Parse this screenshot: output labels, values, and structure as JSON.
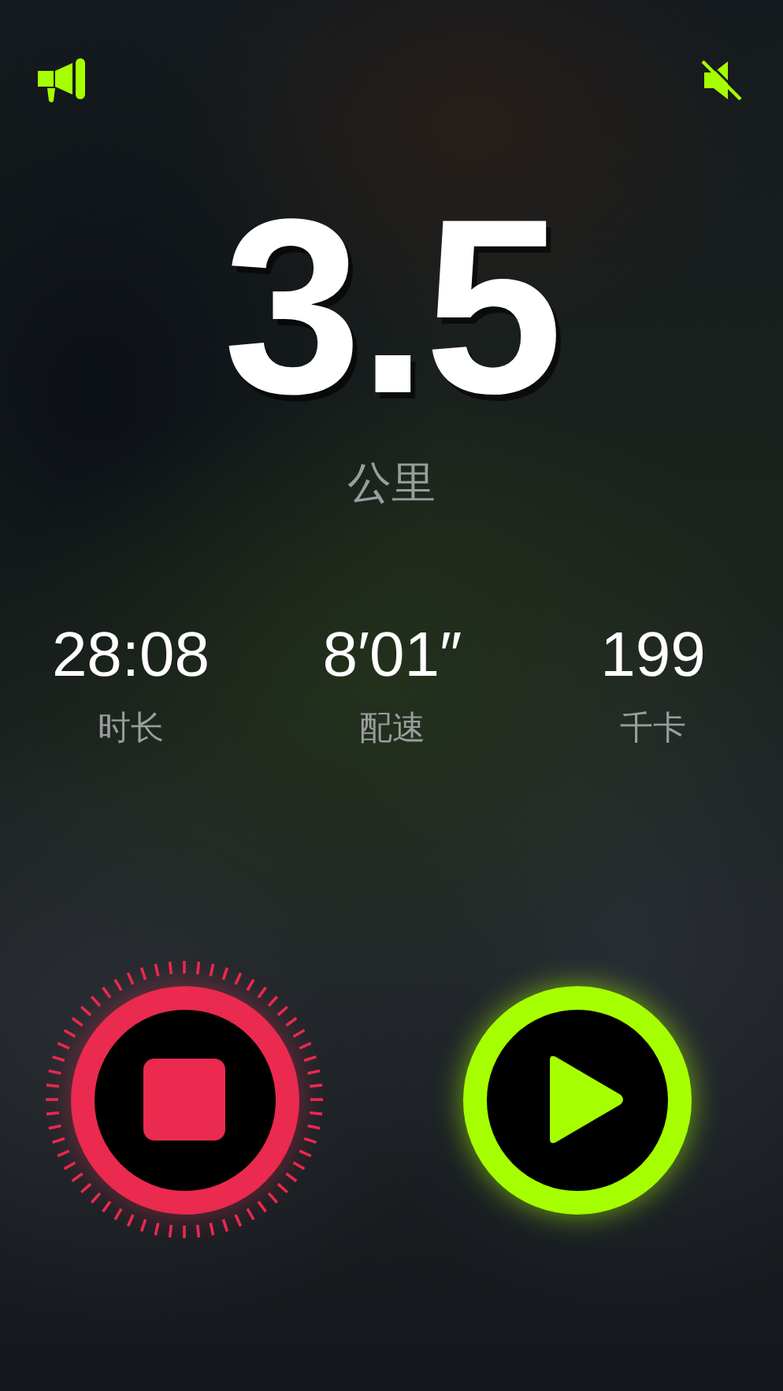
{
  "top_bar": {
    "sound_muted": true
  },
  "distance": {
    "value": "3.5",
    "unit": "公里"
  },
  "stats": [
    {
      "value": "28:08",
      "label": "时长"
    },
    {
      "value": "8′01″",
      "label": "配速"
    },
    {
      "value": "199",
      "label": "千卡"
    }
  ],
  "controls": [
    {
      "kind": "stop"
    },
    {
      "kind": "play"
    }
  ]
}
